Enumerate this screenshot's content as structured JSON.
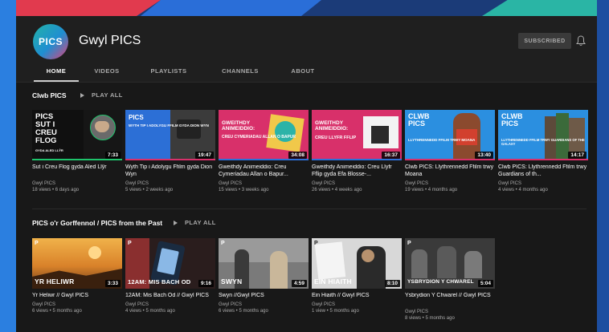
{
  "colors": {
    "background": "#181818",
    "header": "#1f1f1f",
    "text": "#ffffff",
    "muted": "#aaaaaa"
  },
  "channel": {
    "avatar_text": "PICS",
    "name": "Gwyl PICS",
    "subscribe_label": "SUBSCRIBED",
    "bell_icon": "bell-icon"
  },
  "tabs": [
    {
      "label": "HOME",
      "active": true
    },
    {
      "label": "VIDEOS",
      "active": false
    },
    {
      "label": "PLAYLISTS",
      "active": false
    },
    {
      "label": "CHANNELS",
      "active": false
    },
    {
      "label": "ABOUT",
      "active": false
    }
  ],
  "sections": [
    {
      "title": "Clwb PICS",
      "play_all": "PLAY ALL",
      "videos": [
        {
          "title": "Sut i Creu Flog gyda Aled Llŷr",
          "channel": "Gwyl PICS",
          "views": "18 views • 6 days ago",
          "duration": "7:33",
          "thumb_text": "PICS\nSUT I\nCREU\nFLOG",
          "thumb_sub": "GYDA ALED LLŶR",
          "thumb_bg": "#1a1a1a"
        },
        {
          "title": "Wyth Tip i Adolygu Ffilm gyda Dion Wyn",
          "channel": "Gwyl PICS",
          "views": "5 views • 2 weeks ago",
          "duration": "19:47",
          "thumb_text": "PICS",
          "thumb_sub": "WYTH TIP I ADOLYGU FFILM\nGYDA DION WYN",
          "thumb_bg": "#2c6fd6"
        },
        {
          "title": "Gweithdy Animeiddio: Creu Cymeriadau Allan o Bapur...",
          "channel": "Gwyl PICS",
          "views": "15 views • 3 weeks ago",
          "duration": "34:08",
          "thumb_text": "GWEITHDY\nANIMEIDDIO:",
          "thumb_sub": "CREU CYMERIADAU\nALLAN O BAPUR",
          "thumb_bg": "#d8306a"
        },
        {
          "title": "Gweithdy Animeiddio: Creu Llyfr Fflip gyda Efa Blosse-...",
          "channel": "Gwyl PICS",
          "views": "26 views • 4 weeks ago",
          "duration": "16:37",
          "thumb_text": "GWEITHDY\nANIMEIDDIO:",
          "thumb_sub": "CREU LLYFR\nFFLIP",
          "thumb_bg": "#d8306a"
        },
        {
          "title": "Clwb PICS: Llythrennedd Ffilm trwy Moana",
          "channel": "Gwyl PICS",
          "views": "19 views • 4 months ago",
          "duration": "13:40",
          "thumb_text": "CLWB\nPICS",
          "thumb_sub": "LLYTHRENNEDD FFILM\nTRWY MOANA",
          "thumb_bg": "#2b8fe0"
        },
        {
          "title": "Clwb PICS: Llythrennedd Ffilm trwy Guardians of th...",
          "channel": "Gwyl PICS",
          "views": "4 views • 4 months ago",
          "duration": "14:17",
          "thumb_text": "CLWB\nPICS",
          "thumb_sub": "LLYTHRENNEDD FFILM\nTRWY GUARDIANS OF THE GALAXY",
          "thumb_bg": "#2b8fe0"
        }
      ]
    },
    {
      "title": "PICS o'r Gorffennol / PICS from the Past",
      "play_all": "PLAY ALL",
      "videos": [
        {
          "title": "Yr Heliwr // Gwyl PICS",
          "channel": "Gwyl PICS",
          "views": "6 views • 5 months ago",
          "duration": "3:33",
          "thumb_caption": "YR HELIWR",
          "thumb_bg": "#d98a2c"
        },
        {
          "title": "12AM: Mis Bach Od // Gwyl PICS",
          "channel": "Gwyl PICS",
          "views": "4 views • 5 months ago",
          "duration": "9:16",
          "thumb_caption": "12AM: MIS BACH OD",
          "thumb_bg": "#3a2424"
        },
        {
          "title": "Swyn //Gwyl PICS",
          "channel": "Gwyl PICS",
          "views": "6 views • 5 months ago",
          "duration": "4:59",
          "thumb_caption": "SWYN",
          "thumb_bg": "#6a6a6a"
        },
        {
          "title": "Ein Hiaith // Gwyl PICS",
          "channel": "Gwyl PICS",
          "views": "1 view • 5 months ago",
          "duration": "8:10",
          "thumb_caption": "EIN HIAITH",
          "thumb_bg": "#8e8e8e"
        },
        {
          "title": "Ysbrydion Y Chwarel // Gwyl PICS",
          "channel": "Gwyl PICS",
          "views": "8 views • 5 months ago",
          "duration": "5:04",
          "thumb_caption": "YSBRYDION Y CHWAREL",
          "thumb_bg": "#4a4a4a"
        }
      ]
    }
  ]
}
